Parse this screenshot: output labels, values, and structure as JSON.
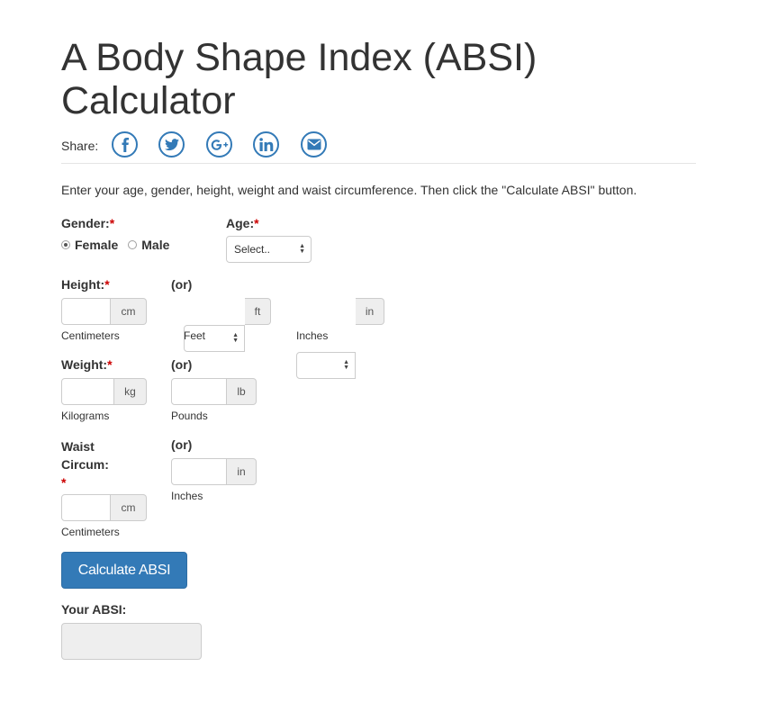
{
  "page": {
    "title": "A Body Shape Index (ABSI) Calculator",
    "share_label": "Share:",
    "share_icons": [
      "facebook-icon",
      "twitter-icon",
      "google-plus-icon",
      "linkedin-icon",
      "email-icon"
    ],
    "intro": "Enter your age, gender, height, weight and waist circumference. Then click the \"Calculate ABSI\" button."
  },
  "form": {
    "required_mark": "*",
    "or_label": "(or)",
    "gender": {
      "label": "Gender:",
      "options": [
        "Female",
        "Male"
      ],
      "selected": "Female"
    },
    "age": {
      "label": "Age:",
      "value": "Select.."
    },
    "height": {
      "label": "Height:",
      "cm_unit": "cm",
      "cm_caption": "Centimeters",
      "ft_unit": "ft",
      "ft_caption": "Feet",
      "in_unit": "in",
      "in_caption": "Inches"
    },
    "weight": {
      "label": "Weight:",
      "kg_unit": "kg",
      "kg_caption": "Kilograms",
      "lb_unit": "lb",
      "lb_caption": "Pounds"
    },
    "waist": {
      "label_line1": "Waist",
      "label_line2": "Circum:",
      "in_unit": "in",
      "in_caption": "Inches",
      "cm_unit": "cm",
      "cm_caption": "Centimeters"
    },
    "calculate_button": "Calculate ABSI",
    "result_label": "Your ABSI:",
    "result_value": ""
  },
  "colors": {
    "primary": "#337ab7",
    "required": "#cc0000",
    "addon_bg": "#eeeeee",
    "border": "#cccccc"
  }
}
